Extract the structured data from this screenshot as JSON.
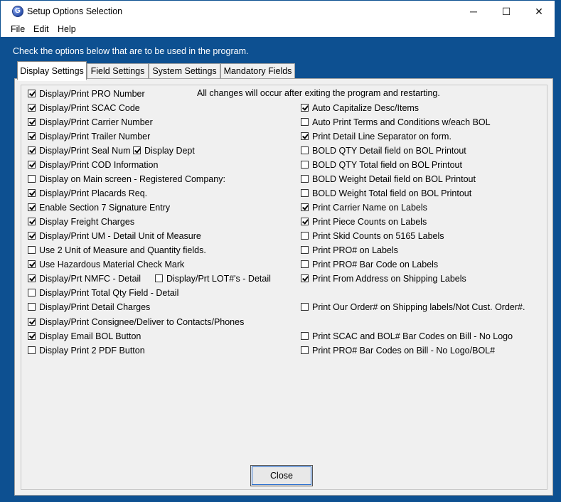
{
  "window": {
    "title": "Setup Options Selection",
    "minimize": "─",
    "maximize": "☐",
    "close": "✕",
    "icon_letter": "G"
  },
  "menu": [
    "File",
    "Edit",
    "Help"
  ],
  "banner": "Check the options below that are to be used in the program.",
  "tabs": [
    "Display Settings",
    "Field Settings",
    "System Settings",
    "Mandatory Fields"
  ],
  "notice": "All changes will occur after exiting the program and restarting.",
  "left_options": [
    {
      "label": "Display/Print PRO Number",
      "checked": true
    },
    {
      "label": "Display/Print SCAC Code",
      "checked": true
    },
    {
      "label": "Display/Print Carrier Number",
      "checked": true
    },
    {
      "label": "Display/Print Trailer Number",
      "checked": true
    },
    {
      "label": "Display/Print Seal Num",
      "checked": true
    },
    {
      "label": "Display/Print COD Information",
      "checked": true
    },
    {
      "label": "Display on Main screen - Registered Company:",
      "checked": false
    },
    {
      "label": "Display/Print Placards Req.",
      "checked": true
    },
    {
      "label": "Enable Section 7 Signature Entry",
      "checked": true
    },
    {
      "label": "Display Freight Charges",
      "checked": true
    },
    {
      "label": "Display/Print UM - Detail Unit of Measure",
      "checked": true
    },
    {
      "label": "Use 2 Unit of Measure and Quantity fields.",
      "checked": false
    },
    {
      "label": "Use Hazardous Material Check Mark",
      "checked": true
    },
    {
      "label": "Display/Prt NMFC - Detail",
      "checked": true
    },
    {
      "label": "Display/Print Total Qty Field - Detail",
      "checked": false
    },
    {
      "label": "Display/Print Detail Charges",
      "checked": false
    },
    {
      "label": "Display/Print Consignee/Deliver to Contacts/Phones",
      "checked": true
    },
    {
      "label": "Display Email BOL Button",
      "checked": true
    },
    {
      "label": "Display Print 2 PDF Button",
      "checked": false
    }
  ],
  "extra_options": {
    "display_dept": {
      "label": "Display Dept",
      "checked": true
    },
    "lot": {
      "label": "Display/Prt LOT#'s - Detail",
      "checked": false
    }
  },
  "right_options": [
    {
      "label": "Auto Capitalize Desc/Items",
      "checked": true
    },
    {
      "label": "Auto Print Terms and Conditions w/each BOL",
      "checked": false
    },
    {
      "label": "Print Detail Line Separator on form.",
      "checked": true
    },
    {
      "label": "BOLD QTY Detail field on BOL Printout",
      "checked": false
    },
    {
      "label": "BOLD QTY Total field on BOL Printout",
      "checked": false
    },
    {
      "label": "BOLD Weight Detail field on BOL Printout",
      "checked": false
    },
    {
      "label": "BOLD Weight Total field on BOL Printout",
      "checked": false
    },
    {
      "label": "Print Carrier Name on Labels",
      "checked": true
    },
    {
      "label": "Print Piece Counts on Labels",
      "checked": true
    },
    {
      "label": "Print Skid Counts on 5165 Labels",
      "checked": false
    },
    {
      "label": "Print PRO# on Labels",
      "checked": false
    },
    {
      "label": "Print PRO# Bar Code on Labels",
      "checked": false
    },
    {
      "label": "Print From Address on Shipping Labels",
      "checked": true
    },
    {
      "label": "Print Our Order# on Shipping labels/Not Cust. Order#.",
      "checked": false
    },
    {
      "label": "Print SCAC and BOL# Bar Codes on Bill - No Logo",
      "checked": false
    },
    {
      "label": "Print PRO# Bar Codes on Bill - No Logo/BOL#",
      "checked": false
    }
  ],
  "close_button": "Close"
}
